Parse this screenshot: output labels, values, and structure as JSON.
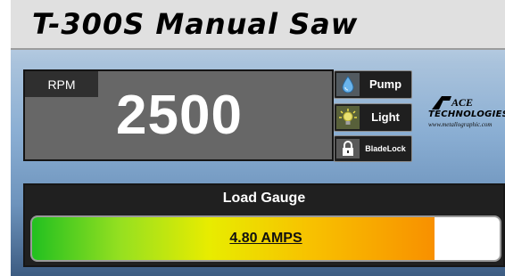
{
  "app": {
    "title": "T-300S Manual Saw"
  },
  "rpm": {
    "label": "RPM",
    "value": "2500"
  },
  "controls": {
    "pump": {
      "label": "Pump",
      "icon": "water-drop-icon"
    },
    "light": {
      "label": "Light",
      "icon": "light-bulb-icon"
    },
    "blade_lock": {
      "label_line1": "Blade",
      "label_line2": "Lock",
      "icon": "padlock-icon"
    }
  },
  "logo": {
    "ace": "ACE",
    "technologies": "TECHNOLOGIES",
    "url": "www.metallographic.com"
  },
  "load_gauge": {
    "title": "Load Gauge",
    "reading": "4.80 AMPS",
    "fill_fraction": 0.86
  },
  "colors": {
    "panel_dark": "#202020",
    "display_gray": "#676767",
    "gauge_green": "#22c020",
    "gauge_yellow": "#e8ec00",
    "gauge_orange": "#f89000",
    "accent_blue": "#5aa8e8"
  }
}
